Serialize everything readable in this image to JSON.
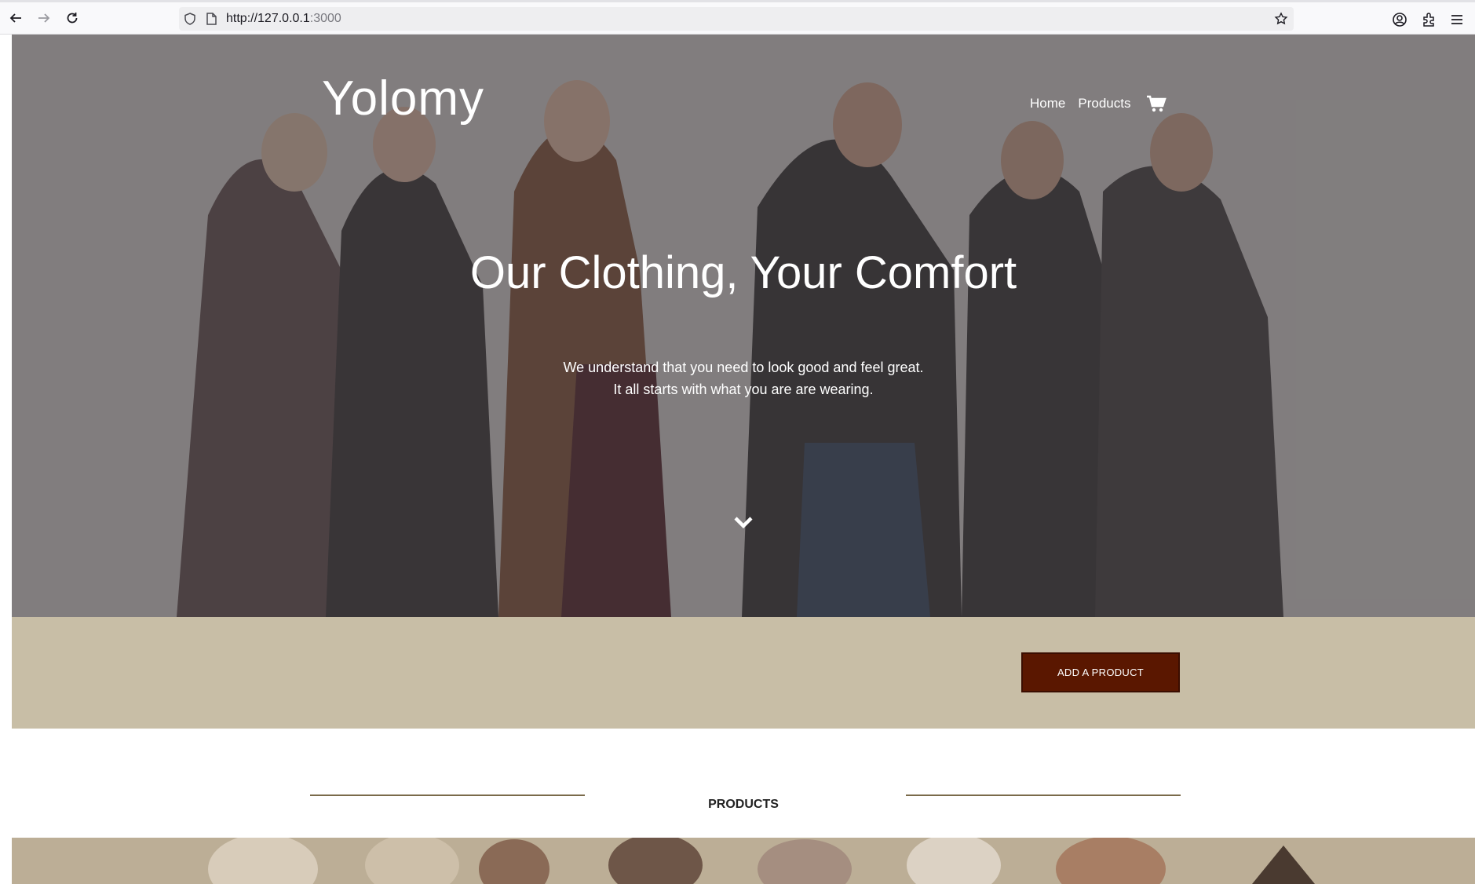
{
  "browser": {
    "url_host": "http://127.0.0.1",
    "url_port": ":3000",
    "back_icon": "arrow-left-icon",
    "forward_icon": "arrow-right-icon",
    "reload_icon": "reload-icon"
  },
  "header": {
    "logo": "Yolomy",
    "nav": [
      {
        "label": "Home"
      },
      {
        "label": "Products"
      }
    ],
    "cart_icon": "cart-icon"
  },
  "hero": {
    "title": "Our Clothing, Your Comfort",
    "subtitle_line1": "We understand that you need to look good and feel great.",
    "subtitle_line2": "It all starts with what you are are wearing.",
    "scroll_icon": "chevron-down-icon"
  },
  "actions": {
    "add_product_label": "ADD A PRODUCT",
    "add_product_bg": "#5a1700",
    "band_color": "#c8bea6"
  },
  "products": {
    "title": "PRODUCTS",
    "rule_color": "#7a6a4a"
  }
}
